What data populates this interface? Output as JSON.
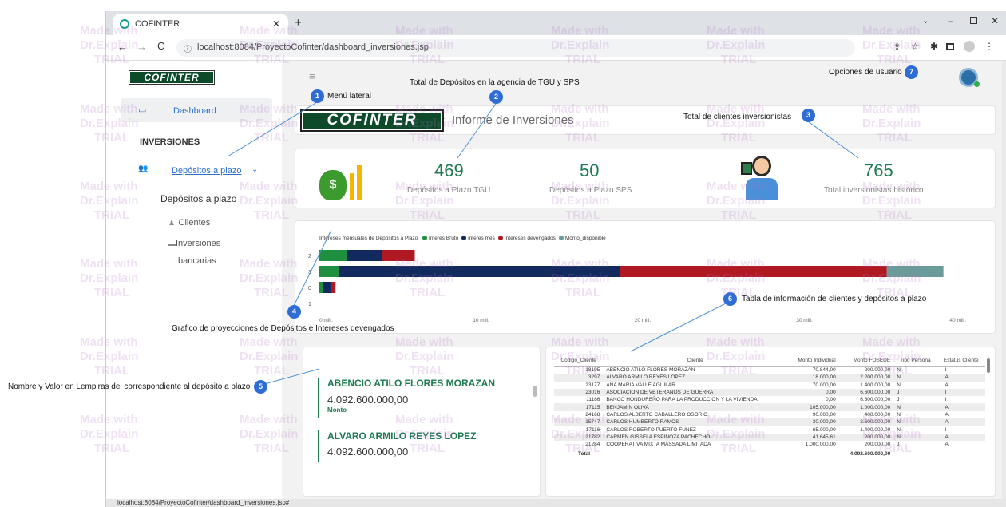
{
  "browser": {
    "tab_title": "COFINTER",
    "url": "localhost:8084/ProyectoCofinter/dashboard_inversiones.jsp",
    "status_url": "localhost:8084/ProyectoCofinter/dashboard_inversiones.jsp#"
  },
  "sidebar": {
    "logo": "COFINTER",
    "dashboard": "Dashboard",
    "section": "INVERSIONES",
    "depositos_menu": "Depósitos a plazo",
    "sub_title": "Depósitos a plazo",
    "sub_items": [
      "Clientes",
      "Inversiones",
      "bancarias"
    ]
  },
  "header": {
    "banner_logo": "COFINTER",
    "banner_title": "Informe de Inversiones"
  },
  "kpis": [
    {
      "value": "469",
      "label": "Depósitos a Plazo TGU"
    },
    {
      "value": "50",
      "label": "Depósitos a Plazo SPS"
    },
    {
      "value": "765",
      "label": "Total inversionistas histórico"
    }
  ],
  "chart_data": {
    "type": "bar",
    "orientation": "horizontal",
    "stacked": true,
    "title": "Intereses mensuales de Depósitos a Plazo",
    "categories": [
      "2",
      "3",
      "0",
      "1"
    ],
    "series": [
      {
        "name": "Interes Bruto",
        "color": "#1e8f3e",
        "values": [
          1.7,
          1.2,
          0.2,
          0
        ]
      },
      {
        "name": "interes mes",
        "color": "#122a5e",
        "values": [
          2.2,
          17.4,
          0.5,
          0
        ]
      },
      {
        "name": "Intereses devengados",
        "color": "#b01822",
        "values": [
          2.0,
          16.5,
          0.3,
          0
        ]
      },
      {
        "name": "Monto_disponible",
        "color": "#6a9a9a",
        "values": [
          0,
          3.5,
          0,
          0
        ]
      }
    ],
    "x_ticks": [
      "0 mill.",
      "10 mill.",
      "20 mill.",
      "30 mill.",
      "40 mill."
    ],
    "xlim": [
      0,
      40
    ]
  },
  "cards": [
    {
      "name": "ABENCIO ATILO FLORES MORAZAN",
      "value": "4.092.600.000,00",
      "label": "Monto"
    },
    {
      "name": "ALVARO ARMILO REYES LOPEZ",
      "value": "4.092.600.000,00",
      "label": ""
    }
  ],
  "table": {
    "headers": [
      "Codigo_Cliente",
      "Cliente",
      "Monto Individual",
      "Monto FOSEDE",
      "Tipo Persona",
      "Estatus Cliente"
    ],
    "rows": [
      [
        "18195",
        "ABENCIO ATILO FLORES MORAZAN",
        "70.844,00",
        "200.000,00",
        "N",
        "I"
      ],
      [
        "3297",
        "ALVARO ARMILO REYES LOPEZ",
        "18.000,00",
        "2.200.000,00",
        "N",
        "A"
      ],
      [
        "23177",
        "ANA MARIA VALLE AGUILAR",
        "70.000,00",
        "1.400.000,00",
        "N",
        "A"
      ],
      [
        "23016",
        "ASOCIACION DE VETERANOS DE GUERRA",
        "0,00",
        "6.600.000,00",
        "J",
        "I"
      ],
      [
        "11186",
        "BANCO HONDUREÑO PARA LA PRODUCCION Y LA VIVIENDA",
        "0,00",
        "6.600.000,00",
        "J",
        "I"
      ],
      [
        "17115",
        "BENJAMIN OLIVA",
        "105.000,00",
        "1.000.000,00",
        "N",
        "A"
      ],
      [
        "24168",
        "CARLOS ALBERTO CABALLERO OSORIO",
        "90.000,00",
        "400.000,00",
        "N",
        "A"
      ],
      [
        "15747",
        "CARLOS HUMBERTO RAMOS",
        "30.000,00",
        "2.600.000,00",
        "N",
        "A"
      ],
      [
        "17116",
        "CARLOS ROBERTO PUERTO FUNEZ",
        "65.000,00",
        "1.400.000,00",
        "N",
        "I"
      ],
      [
        "21782",
        "CARMEN GISSELA ESPINOZA PACHECHO",
        "41.645,61",
        "200.000,00",
        "N",
        "A"
      ],
      [
        "21284",
        "COOPERATIVA MIXTA MASSADA LIMITADA",
        "1.000.000,00",
        "200.000,00",
        "J",
        "A"
      ]
    ],
    "total_label": "Total",
    "total_value": "4.092.600.000,00"
  },
  "annotations": {
    "a1": "Menú lateral",
    "a2": "Total de Depósitos en la agencia de TGU y SPS",
    "a3": "Total de clientes inversionistas",
    "a4": "Grafico de proyecciones de Depósitos e Intereses devengados",
    "a5": "Nombre y Valor en Lempiras del correspondiente al depósito a plazo",
    "a6": "Tabla de información de clientes y depósitos a plazo",
    "a7": "Opciones de usuario",
    "nums": [
      "1",
      "2",
      "3",
      "4",
      "5",
      "6",
      "7"
    ]
  },
  "watermark": {
    "l1": "Made with",
    "l2": "Dr.Explain",
    "l3": "TRIAL"
  }
}
